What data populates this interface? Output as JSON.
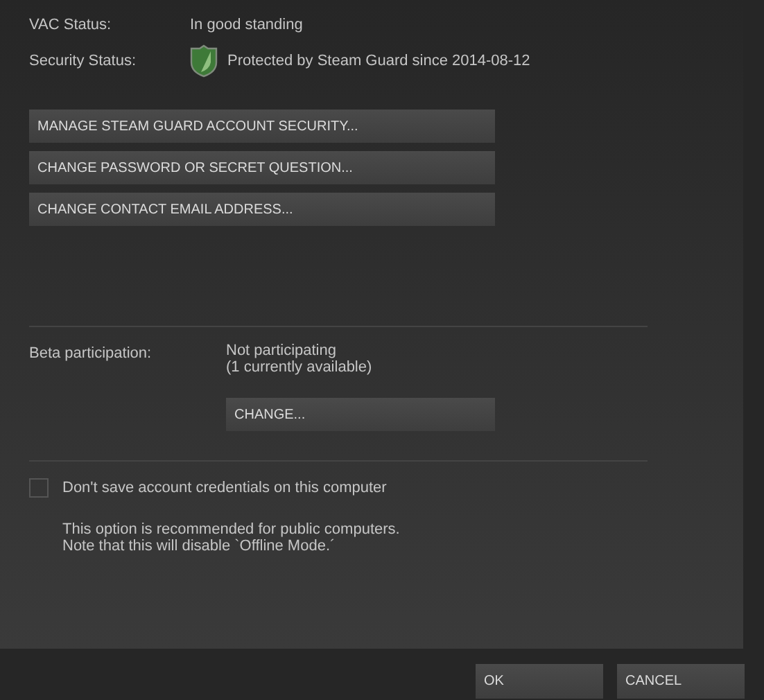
{
  "vac_status": {
    "label": "VAC Status:",
    "value": "In good standing"
  },
  "security_status": {
    "label": "Security Status:",
    "value": "Protected by Steam Guard since 2014-08-12"
  },
  "account_buttons": [
    "MANAGE STEAM GUARD ACCOUNT SECURITY...",
    "CHANGE PASSWORD OR SECRET QUESTION...",
    "CHANGE CONTACT EMAIL ADDRESS..."
  ],
  "beta": {
    "label": "Beta participation:",
    "value_lines": [
      "Not participating",
      "(1 currently available)"
    ],
    "button": "CHANGE..."
  },
  "credentials": {
    "label": "Don't save account credentials on this computer",
    "checked": false,
    "note_lines": [
      "This option is recommended for public computers.",
      "Note that this will disable `Offline Mode.´"
    ]
  },
  "dialog_buttons": [
    "OK",
    "CANCEL"
  ]
}
